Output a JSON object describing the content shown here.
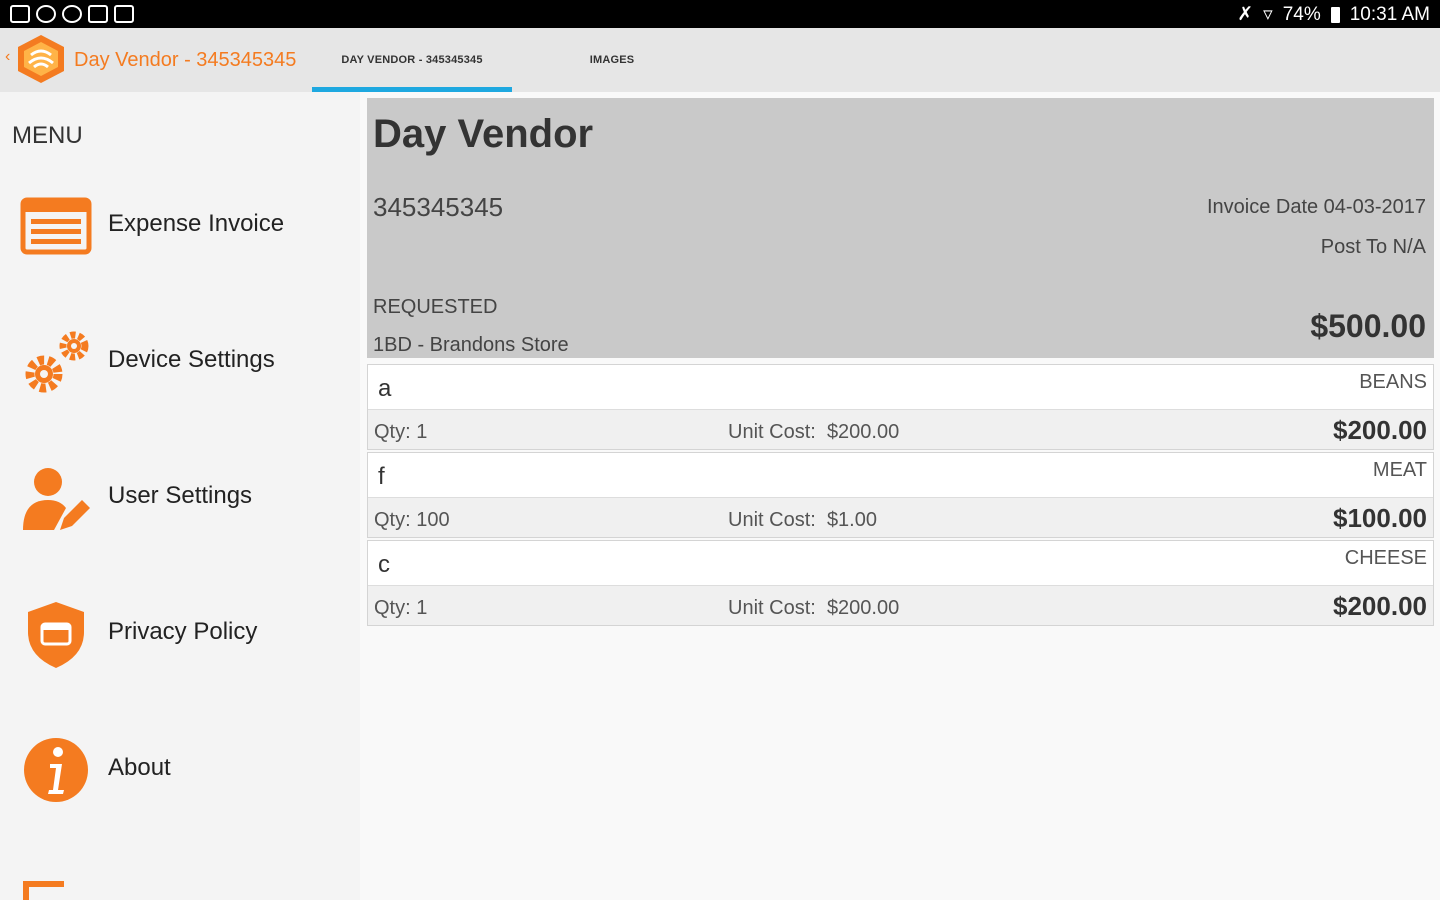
{
  "status_bar": {
    "battery": "74%",
    "time": "10:31 AM"
  },
  "app_bar": {
    "title": "Day Vendor - 345345345",
    "tabs": [
      {
        "label": "DAY VENDOR - 345345345",
        "active": true
      },
      {
        "label": "IMAGES",
        "active": false
      }
    ]
  },
  "sidebar": {
    "menu_label": "MENU",
    "items": [
      {
        "label": "Expense Invoice",
        "icon": "invoice-icon"
      },
      {
        "label": "Device Settings",
        "icon": "gears-icon"
      },
      {
        "label": "User Settings",
        "icon": "user-edit-icon"
      },
      {
        "label": "Privacy Policy",
        "icon": "shield-icon"
      },
      {
        "label": "About",
        "icon": "info-icon"
      }
    ]
  },
  "invoice": {
    "vendor": "Day Vendor",
    "id": "345345345",
    "date": "Invoice Date 04-03-2017",
    "post_to": "Post To N/A",
    "status": "REQUESTED",
    "store": "1BD - Brandons Store",
    "total": "$500.00",
    "unit_cost_label": "Unit Cost:",
    "lines": [
      {
        "code": "a",
        "category": "BEANS",
        "qty": "Qty: 1",
        "unit_cost": "$200.00",
        "amount": "$200.00"
      },
      {
        "code": "f",
        "category": "MEAT",
        "qty": "Qty: 100",
        "unit_cost": "$1.00",
        "amount": "$100.00"
      },
      {
        "code": "c",
        "category": "CHEESE",
        "qty": "Qty: 1",
        "unit_cost": "$200.00",
        "amount": "$200.00"
      }
    ]
  },
  "colors": {
    "accent": "#f47b20",
    "tab_indicator": "#1ea8e0"
  }
}
